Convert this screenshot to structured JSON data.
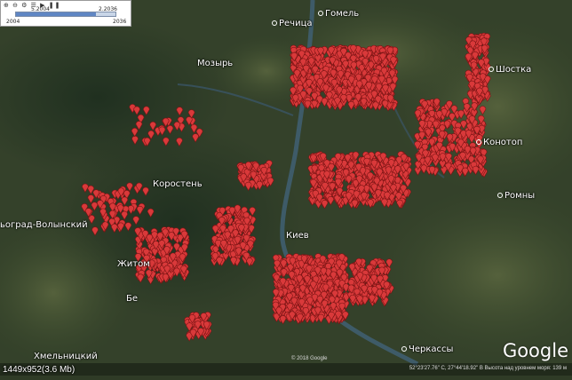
{
  "timeline": {
    "start_label": "5.2004",
    "end_label": "2.2036",
    "min_year": "2004",
    "max_year": "2036",
    "tool_icons": [
      "search-plus-icon",
      "search-minus-icon",
      "settings-icon",
      "gear-icon",
      "play-icon",
      "pause-icon"
    ],
    "selected_fraction": 0.8
  },
  "cities": [
    {
      "name": "Гомель",
      "dot": true
    },
    {
      "name": "Речица",
      "dot": true
    },
    {
      "name": "Мозырь",
      "dot": false
    },
    {
      "name": "Шостка",
      "dot": true
    },
    {
      "name": "Конотоп",
      "dot": true
    },
    {
      "name": "Коростень",
      "dot": false
    },
    {
      "name": "Ромны",
      "dot": true
    },
    {
      "name": "ьоград-Волынский",
      "dot": false
    },
    {
      "name": "Житом",
      "dot": false
    },
    {
      "name": "Бе",
      "dot": false
    },
    {
      "name": "Киев",
      "dot": false
    },
    {
      "name": "Черкассы",
      "dot": true
    },
    {
      "name": "Хмельницкий",
      "dot": false
    }
  ],
  "google_logo": "Google",
  "copyright": "© 2018 Google",
  "status_text": "52°23'27.76\" С, 27°44'18.92\" В  Высота над уровнем моря: 139 м",
  "caption": "1449x952(3.6 Mb)",
  "colors": {
    "marker": "#d9393a",
    "land_dark": "#2d3a24",
    "forest": "#263622",
    "field": "#4d5a38",
    "water": "#3d5a6a"
  }
}
